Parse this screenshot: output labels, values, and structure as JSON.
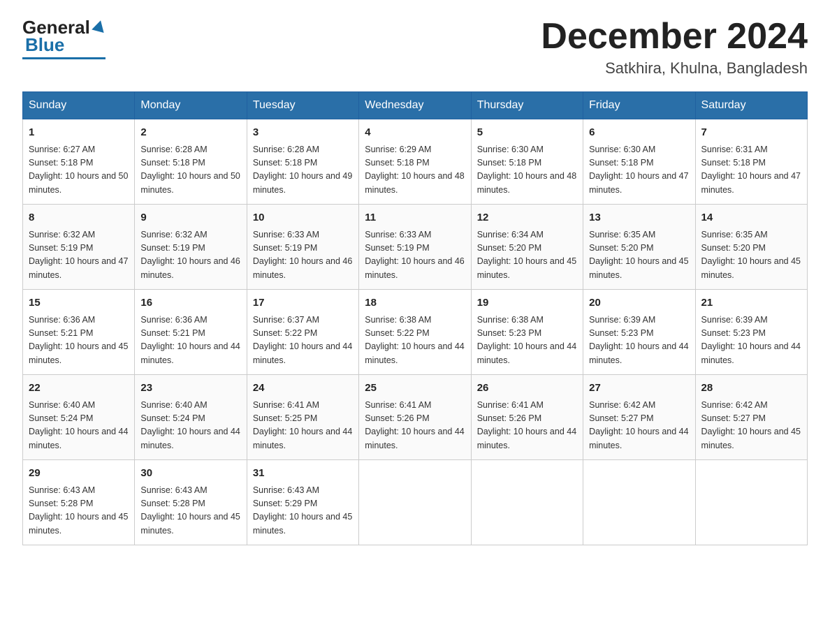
{
  "header": {
    "logo_general": "General",
    "logo_blue": "Blue",
    "month": "December 2024",
    "location": "Satkhira, Khulna, Bangladesh"
  },
  "days_of_week": [
    "Sunday",
    "Monday",
    "Tuesday",
    "Wednesday",
    "Thursday",
    "Friday",
    "Saturday"
  ],
  "weeks": [
    [
      {
        "day": "1",
        "sunrise": "6:27 AM",
        "sunset": "5:18 PM",
        "daylight": "10 hours and 50 minutes."
      },
      {
        "day": "2",
        "sunrise": "6:28 AM",
        "sunset": "5:18 PM",
        "daylight": "10 hours and 50 minutes."
      },
      {
        "day": "3",
        "sunrise": "6:28 AM",
        "sunset": "5:18 PM",
        "daylight": "10 hours and 49 minutes."
      },
      {
        "day": "4",
        "sunrise": "6:29 AM",
        "sunset": "5:18 PM",
        "daylight": "10 hours and 48 minutes."
      },
      {
        "day": "5",
        "sunrise": "6:30 AM",
        "sunset": "5:18 PM",
        "daylight": "10 hours and 48 minutes."
      },
      {
        "day": "6",
        "sunrise": "6:30 AM",
        "sunset": "5:18 PM",
        "daylight": "10 hours and 47 minutes."
      },
      {
        "day": "7",
        "sunrise": "6:31 AM",
        "sunset": "5:18 PM",
        "daylight": "10 hours and 47 minutes."
      }
    ],
    [
      {
        "day": "8",
        "sunrise": "6:32 AM",
        "sunset": "5:19 PM",
        "daylight": "10 hours and 47 minutes."
      },
      {
        "day": "9",
        "sunrise": "6:32 AM",
        "sunset": "5:19 PM",
        "daylight": "10 hours and 46 minutes."
      },
      {
        "day": "10",
        "sunrise": "6:33 AM",
        "sunset": "5:19 PM",
        "daylight": "10 hours and 46 minutes."
      },
      {
        "day": "11",
        "sunrise": "6:33 AM",
        "sunset": "5:19 PM",
        "daylight": "10 hours and 46 minutes."
      },
      {
        "day": "12",
        "sunrise": "6:34 AM",
        "sunset": "5:20 PM",
        "daylight": "10 hours and 45 minutes."
      },
      {
        "day": "13",
        "sunrise": "6:35 AM",
        "sunset": "5:20 PM",
        "daylight": "10 hours and 45 minutes."
      },
      {
        "day": "14",
        "sunrise": "6:35 AM",
        "sunset": "5:20 PM",
        "daylight": "10 hours and 45 minutes."
      }
    ],
    [
      {
        "day": "15",
        "sunrise": "6:36 AM",
        "sunset": "5:21 PM",
        "daylight": "10 hours and 45 minutes."
      },
      {
        "day": "16",
        "sunrise": "6:36 AM",
        "sunset": "5:21 PM",
        "daylight": "10 hours and 44 minutes."
      },
      {
        "day": "17",
        "sunrise": "6:37 AM",
        "sunset": "5:22 PM",
        "daylight": "10 hours and 44 minutes."
      },
      {
        "day": "18",
        "sunrise": "6:38 AM",
        "sunset": "5:22 PM",
        "daylight": "10 hours and 44 minutes."
      },
      {
        "day": "19",
        "sunrise": "6:38 AM",
        "sunset": "5:23 PM",
        "daylight": "10 hours and 44 minutes."
      },
      {
        "day": "20",
        "sunrise": "6:39 AM",
        "sunset": "5:23 PM",
        "daylight": "10 hours and 44 minutes."
      },
      {
        "day": "21",
        "sunrise": "6:39 AM",
        "sunset": "5:23 PM",
        "daylight": "10 hours and 44 minutes."
      }
    ],
    [
      {
        "day": "22",
        "sunrise": "6:40 AM",
        "sunset": "5:24 PM",
        "daylight": "10 hours and 44 minutes."
      },
      {
        "day": "23",
        "sunrise": "6:40 AM",
        "sunset": "5:24 PM",
        "daylight": "10 hours and 44 minutes."
      },
      {
        "day": "24",
        "sunrise": "6:41 AM",
        "sunset": "5:25 PM",
        "daylight": "10 hours and 44 minutes."
      },
      {
        "day": "25",
        "sunrise": "6:41 AM",
        "sunset": "5:26 PM",
        "daylight": "10 hours and 44 minutes."
      },
      {
        "day": "26",
        "sunrise": "6:41 AM",
        "sunset": "5:26 PM",
        "daylight": "10 hours and 44 minutes."
      },
      {
        "day": "27",
        "sunrise": "6:42 AM",
        "sunset": "5:27 PM",
        "daylight": "10 hours and 44 minutes."
      },
      {
        "day": "28",
        "sunrise": "6:42 AM",
        "sunset": "5:27 PM",
        "daylight": "10 hours and 45 minutes."
      }
    ],
    [
      {
        "day": "29",
        "sunrise": "6:43 AM",
        "sunset": "5:28 PM",
        "daylight": "10 hours and 45 minutes."
      },
      {
        "day": "30",
        "sunrise": "6:43 AM",
        "sunset": "5:28 PM",
        "daylight": "10 hours and 45 minutes."
      },
      {
        "day": "31",
        "sunrise": "6:43 AM",
        "sunset": "5:29 PM",
        "daylight": "10 hours and 45 minutes."
      },
      null,
      null,
      null,
      null
    ]
  ]
}
